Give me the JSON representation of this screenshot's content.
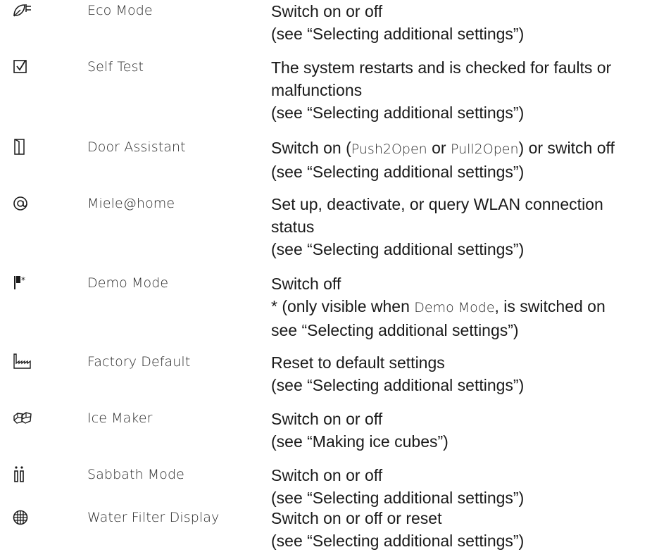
{
  "rows": [
    {
      "icon": "eco-leaf-plug-icon",
      "name": "Eco Mode",
      "lines": [
        "Switch on or off",
        "(see “Selecting additional settings”)"
      ]
    },
    {
      "icon": "checkbox-icon",
      "name": "Self Test",
      "lines": [
        "The system restarts and is checked for faults or",
        "malfunctions",
        "(see “Selecting additional settings”)"
      ]
    },
    {
      "icon": "door-icon",
      "name": "Door Assistant",
      "line1": {
        "a": "Switch on (",
        "b": "Push2Open",
        "c": " or ",
        "d": "Pull2Open",
        "e": ") or switch off"
      },
      "lines": [
        "(see “Selecting additional settings”)"
      ]
    },
    {
      "icon": "at-sign-icon",
      "name": "Miele@home",
      "lines": [
        "Set up, deactivate, or query WLAN connection",
        "status",
        "(see “Selecting additional settings”)"
      ]
    },
    {
      "icon": "demo-flag-icon",
      "name": "Demo Mode",
      "lines": [
        "Switch off"
      ],
      "line2": {
        "a": "* (only visible when ",
        "b": "Demo Mode",
        "c": ", is switched on"
      },
      "line3": "see “Selecting additional settings”)"
    },
    {
      "icon": "factory-icon",
      "name": "Factory Default",
      "lines": [
        "Reset to default settings",
        "(see “Selecting additional settings”)"
      ]
    },
    {
      "icon": "ice-cubes-icon",
      "name": "Ice Maker",
      "lines": [
        "Switch on or off",
        "(see “Making ice cubes”)"
      ]
    },
    {
      "icon": "sabbath-candles-icon",
      "name": "Sabbath Mode",
      "lines": [
        "Switch on or off",
        "(see “Selecting additional settings”)"
      ]
    },
    {
      "icon": "water-filter-icon",
      "name": "Water Filter Display",
      "lines": [
        "Switch on or off or reset",
        "(see “Selecting additional settings”)"
      ]
    }
  ]
}
